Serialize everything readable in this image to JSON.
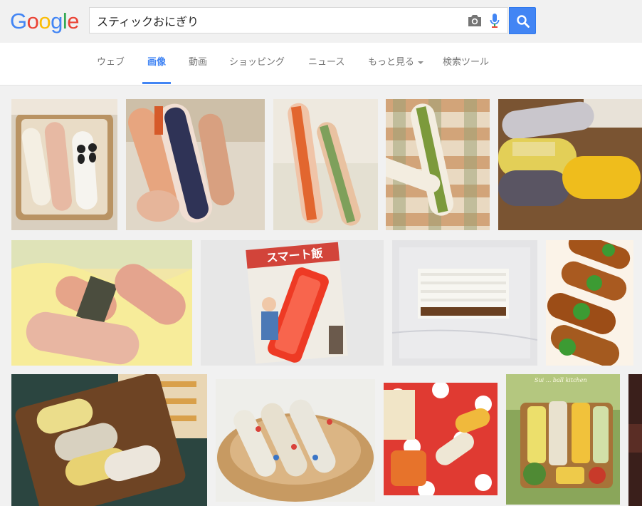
{
  "logo": {
    "letters": [
      "G",
      "o",
      "o",
      "g",
      "l",
      "e"
    ],
    "colors": [
      "#4285f4",
      "#ea4335",
      "#fbbc05",
      "#4285f4",
      "#34a853",
      "#ea4335"
    ]
  },
  "search": {
    "query": "スティックおにぎり",
    "button_icon": "magnifier-icon",
    "camera_icon": "camera-icon",
    "mic_icon": "microphone-icon"
  },
  "tabs": [
    {
      "label": "ウェブ",
      "active": false
    },
    {
      "label": "画像",
      "active": true
    },
    {
      "label": "動画",
      "active": false
    },
    {
      "label": "ショッピング",
      "active": false
    },
    {
      "label": "ニュース",
      "active": false
    },
    {
      "label": "もっと見る",
      "active": false,
      "has_dropdown": true
    },
    {
      "label": "検索ツール",
      "active": false
    }
  ],
  "colors": {
    "accent": "#4285f4",
    "tab_text": "#777777",
    "header_bg": "#f1f1f1"
  },
  "thumbnails": {
    "row1": [
      {
        "subject": "stick onigiri with cat and panda faces in a basket"
      },
      {
        "subject": "hand holding wrapped stick onigiri"
      },
      {
        "subject": "salmon and cucumber stick rolls on cloth"
      },
      {
        "subject": "cucumber stick onigiri on checked napkin"
      },
      {
        "subject": "yellow and sesame rice sticks in plastic wrap"
      }
    ],
    "row2": [
      {
        "subject": "wrapped salmon stick onigiri on yellow napkin"
      },
      {
        "subject": "スマート飯 stick onigiri maker package",
        "text": "スマート飯"
      },
      {
        "subject": "rice spread on plastic wrap with filling"
      },
      {
        "subject": "meat-wrapped rice sticks with shiso leaves"
      }
    ],
    "row3": [
      {
        "subject": "egg and furikake rice sticks on wooden board"
      },
      {
        "subject": "stick onigiri in a wicker basket"
      },
      {
        "subject": "candy-wrapped onigiri on red polka dot cloth"
      },
      {
        "subject": "bento of colorful stick rolls",
        "text": "Sui ... ball kitchen"
      },
      {
        "subject": "partial image"
      }
    ]
  }
}
